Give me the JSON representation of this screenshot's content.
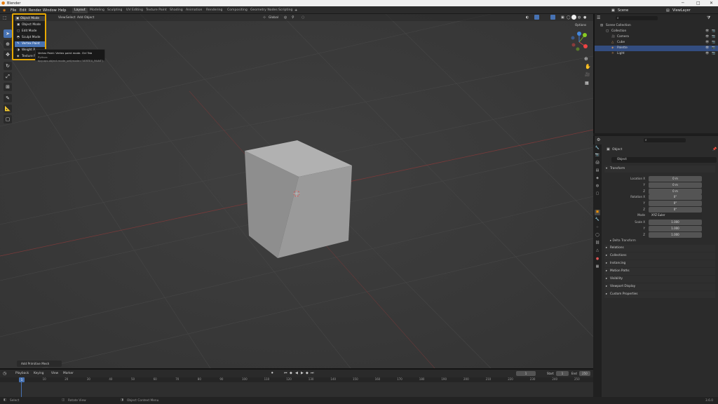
{
  "title_bar": {
    "app_title": "Blender",
    "minimize": "─",
    "maximize": "□",
    "close": "✕"
  },
  "menu": [
    "File",
    "Edit",
    "Render",
    "Window",
    "Help"
  ],
  "workspaces": [
    "Layout",
    "Modeling",
    "Sculpting",
    "UV Editing",
    "Texture Paint",
    "Shading",
    "Animation",
    "Rendering",
    "Compositing",
    "Geometry Nodes",
    "Scripting"
  ],
  "active_workspace": "Layout",
  "scene": {
    "label": "Scene",
    "view_layer": "ViewLayer"
  },
  "viewport_header": {
    "menus": [
      "View",
      "Select",
      "Add",
      "Object"
    ],
    "orientation": "Global",
    "options": "Options"
  },
  "mode_menu": {
    "current": "Object Mode",
    "items": [
      {
        "icon": "object-mode-icon",
        "label": "Object Mode"
      },
      {
        "icon": "edit-mode-icon",
        "label": "Edit Mode"
      },
      {
        "icon": "sculpt-mode-icon",
        "label": "Sculpt Mode"
      },
      {
        "icon": "vertex-paint-icon",
        "label": "Vertex Paint"
      },
      {
        "icon": "weight-paint-icon",
        "label": "Weight P..."
      },
      {
        "icon": "texture-paint-icon",
        "label": "Texture P..."
      }
    ],
    "highlighted_index": 3
  },
  "tooltip": {
    "line1": "Vertex Paint: Vertex paint mode. Ctrl Tab",
    "line2": "Python: bpy.ops.object.mode_set(mode='VERTEX_PAINT')"
  },
  "outliner": {
    "search_placeholder": "",
    "rows": [
      {
        "label": "Scene Collection",
        "indent": 0,
        "selected": false
      },
      {
        "label": "Collection",
        "indent": 1,
        "selected": false
      },
      {
        "label": "Camera",
        "indent": 2,
        "selected": false
      },
      {
        "label": "Cube",
        "indent": 2,
        "selected": false
      },
      {
        "label": "Palette",
        "indent": 2,
        "selected": true
      },
      {
        "label": "Light",
        "indent": 2,
        "selected": false
      }
    ]
  },
  "properties": {
    "object_name": "Object",
    "object_name_field": "Object",
    "panel_transform": "Transform",
    "location_label": "Location X",
    "location": [
      "0 m",
      "0 m",
      "0 m"
    ],
    "rotation_label": "Rotation X",
    "rotation": [
      "0°",
      "0°",
      "0°"
    ],
    "mode_label": "Mode",
    "mode_value": "XYZ Euler",
    "scale_label": "Scale X",
    "scale": [
      "1.000",
      "1.000",
      "1.000"
    ],
    "axis_y": "Y",
    "axis_z": "Z",
    "delta_transform": "Delta Transform",
    "collapsed_panels": [
      "Relations",
      "Collections",
      "Instancing",
      "Motion Paths",
      "Visibility",
      "Viewport Display",
      "Custom Properties"
    ]
  },
  "viewport_footer": {
    "last_op": "Add Primitive Mesh"
  },
  "timeline": {
    "menus": [
      "Playback",
      "Keying",
      "View",
      "Marker"
    ],
    "current_frame": "1",
    "start_label": "Start",
    "start": "1",
    "end_label": "End",
    "end": "250",
    "ticks": [
      "0",
      "10",
      "20",
      "30",
      "40",
      "50",
      "60",
      "70",
      "80",
      "90",
      "100",
      "110",
      "120",
      "130",
      "140",
      "150",
      "160",
      "170",
      "180",
      "190",
      "200",
      "210",
      "220",
      "230",
      "240",
      "250"
    ]
  },
  "status_bar": {
    "select": "Select",
    "rotate": "Rotate View",
    "context": "Object Context Menu",
    "version": "3.6.0"
  },
  "colors": {
    "accent": "#4772b3",
    "highlight_border": "#e8a800",
    "selection_row": "#334d80"
  }
}
